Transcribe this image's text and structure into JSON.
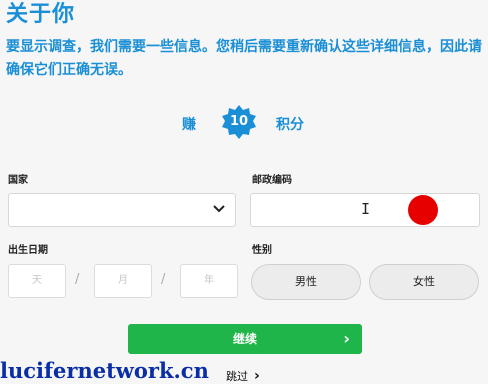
{
  "header": {
    "title": "关于你",
    "description": "要显示调查，我们需要一些信息。您稍后需要重新确认这些详细信息，因此请确保它们正确无误。"
  },
  "earn": {
    "prefix": "赚",
    "points": "10",
    "suffix": "积分",
    "badge_color": "#1a8fd6"
  },
  "form": {
    "country_label": "国家",
    "country_value": "",
    "zip_label": "邮政编码",
    "zip_value": "",
    "birthdate_label": "出生日期",
    "day_placeholder": "天",
    "month_placeholder": "月",
    "year_placeholder": "年",
    "date_separator": "/",
    "gender_label": "性别",
    "gender_options": [
      "男性",
      "女性"
    ]
  },
  "actions": {
    "continue_label": "继续",
    "continue_color": "#20b54a",
    "skip_label": "跳过"
  },
  "watermark": "lucifernetwork.cn",
  "accent_color": "#1a8fd6",
  "marker_color": "#e60000"
}
